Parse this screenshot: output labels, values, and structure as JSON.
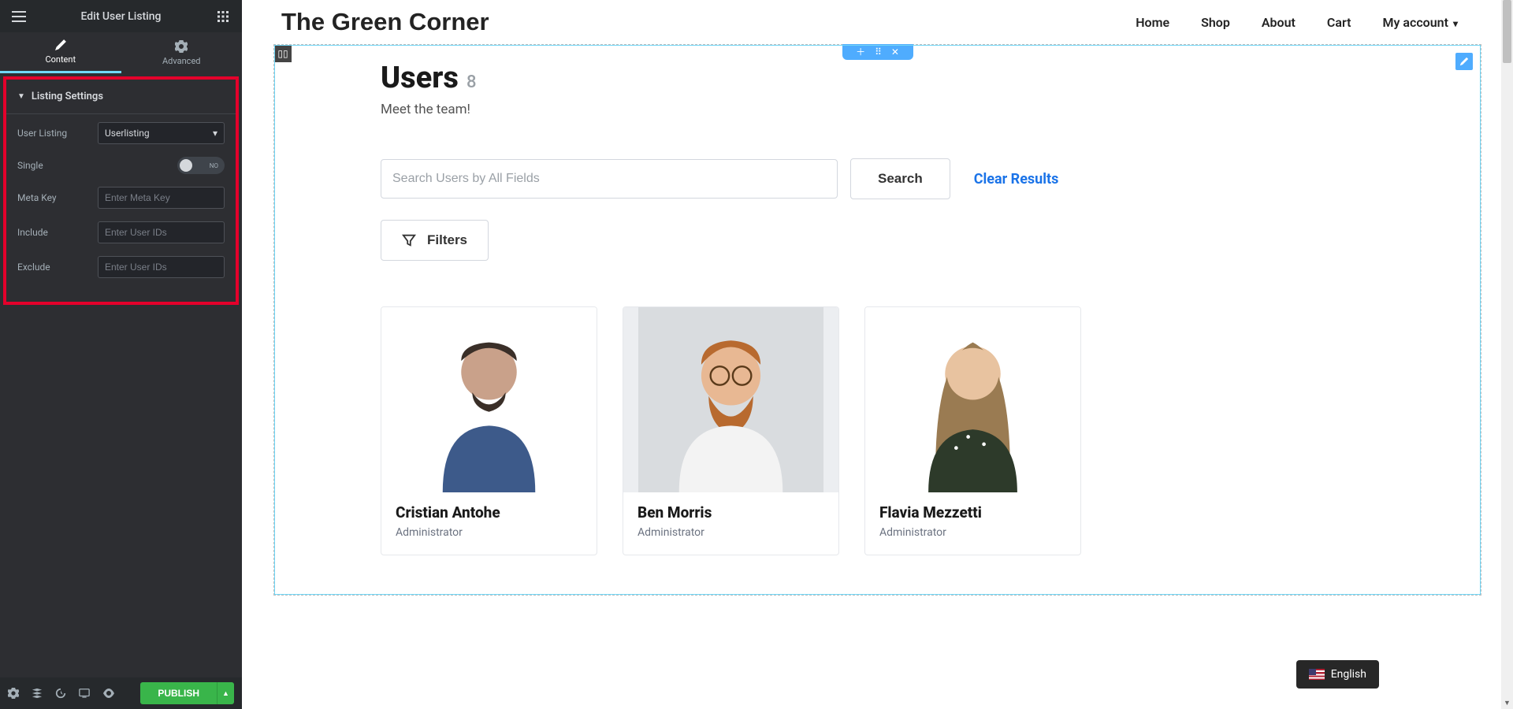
{
  "sidebar": {
    "header_title": "Edit User Listing",
    "tabs": {
      "content": "Content",
      "advanced": "Advanced"
    },
    "section_title": "Listing Settings",
    "controls": {
      "user_listing_label": "User Listing",
      "user_listing_value": "Userlisting",
      "single_label": "Single",
      "single_toggle_text": "NO",
      "meta_key_label": "Meta Key",
      "meta_key_placeholder": "Enter Meta Key",
      "include_label": "Include",
      "include_placeholder": "Enter User IDs",
      "exclude_label": "Exclude",
      "exclude_placeholder": "Enter User IDs"
    },
    "publish_label": "PUBLISH"
  },
  "site": {
    "logo": "The Green Corner",
    "nav": {
      "home": "Home",
      "shop": "Shop",
      "about": "About",
      "cart": "Cart",
      "account": "My account"
    }
  },
  "page": {
    "title": "Users",
    "count": "8",
    "subtitle": "Meet the team!",
    "search_placeholder": "Search Users by All Fields",
    "search_btn": "Search",
    "clear_btn": "Clear Results",
    "filters_btn": "Filters"
  },
  "users": [
    {
      "name": "Cristian Antohe",
      "role": "Administrator"
    },
    {
      "name": "Ben Morris",
      "role": "Administrator"
    },
    {
      "name": "Flavia Mezzetti",
      "role": "Administrator"
    }
  ],
  "lang": {
    "label": "English"
  }
}
